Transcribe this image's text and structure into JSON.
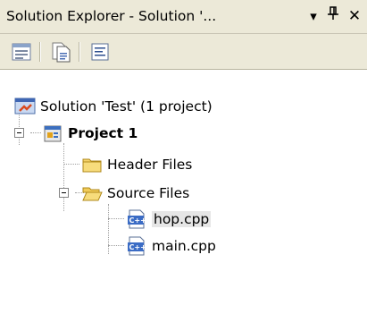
{
  "window": {
    "title": "Solution Explorer - Solution '...",
    "menu_glyph": "▾",
    "pin_glyph": "ф",
    "close_glyph": "✕"
  },
  "toolbar": {
    "buttons": [
      "properties-icon",
      "show-all-files-icon",
      "view-code-icon"
    ]
  },
  "tree": {
    "solution": "Solution 'Test' (1 project)",
    "project": "Project 1",
    "header_files": "Header Files",
    "source_files": "Source Files",
    "files": [
      "hop.cpp",
      "main.cpp"
    ]
  }
}
